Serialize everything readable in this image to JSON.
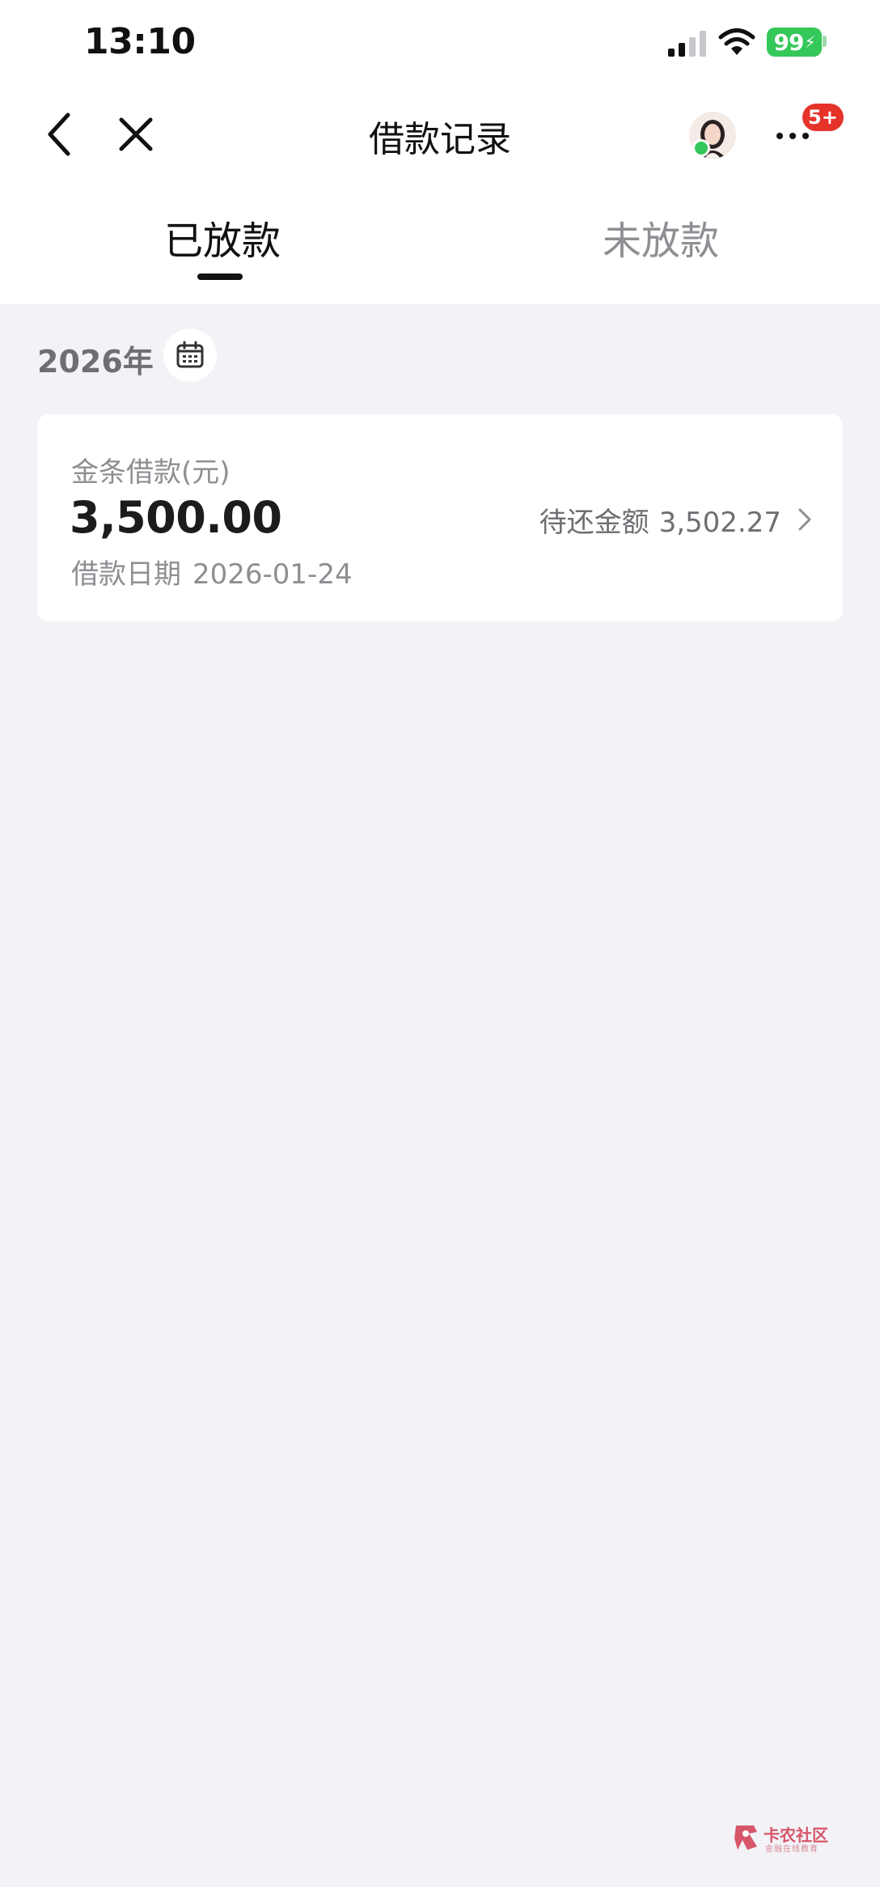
{
  "status_bar": {
    "time": "13:10",
    "battery": "99"
  },
  "nav": {
    "title": "借款记录",
    "badge": "5+"
  },
  "tabs": [
    {
      "label": "已放款",
      "active": true
    },
    {
      "label": "未放款",
      "active": false
    }
  ],
  "filter": {
    "year": "2026年"
  },
  "records": [
    {
      "type_label": "金条借款(元)",
      "amount": "3,500.00",
      "date_label": "借款日期",
      "date": "2026-01-24",
      "due_label": "待还金额",
      "due_amount": "3,502.27"
    }
  ],
  "watermark": {
    "title": "卡农社区",
    "subtitle": "金融在线教育"
  },
  "colors": {
    "battery": "#34c759",
    "badge": "#e5332a",
    "background": "#f2f2f7"
  },
  "icons": [
    "signal-icon",
    "wifi-icon",
    "back-chevron-icon",
    "close-icon",
    "avatar",
    "more-icon",
    "calendar-icon",
    "chevron-right-icon"
  ]
}
